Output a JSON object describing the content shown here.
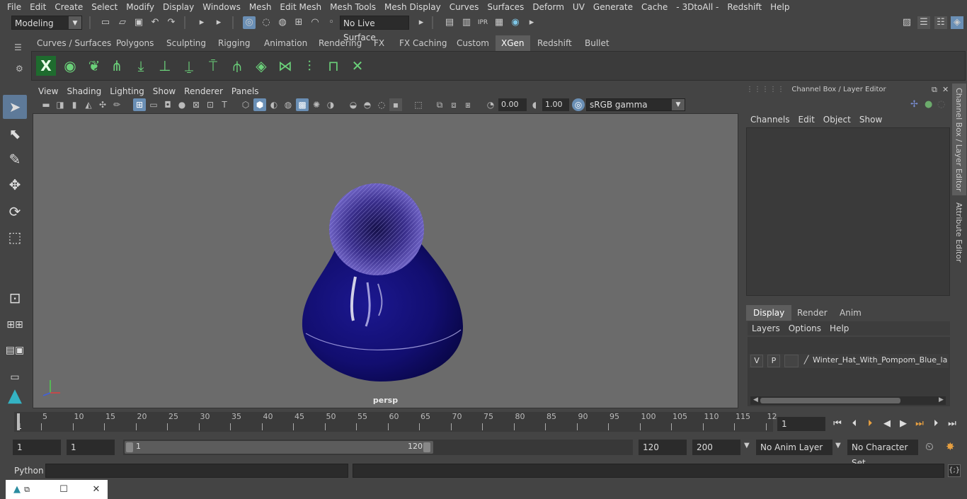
{
  "menubar": {
    "items": [
      "File",
      "Edit",
      "Create",
      "Select",
      "Modify",
      "Display",
      "Windows",
      "Mesh",
      "Edit Mesh",
      "Mesh Tools",
      "Mesh Display",
      "Curves",
      "Surfaces",
      "Deform",
      "UV",
      "Generate",
      "Cache",
      "- 3DtoAll -",
      "Redshift",
      "Help"
    ]
  },
  "statusline": {
    "mode": "Modeling",
    "live_surface": "No Live Surface"
  },
  "shelf": {
    "tabs": [
      "Curves / Surfaces",
      "Polygons",
      "Sculpting",
      "Rigging",
      "Animation",
      "Rendering",
      "FX",
      "FX Caching",
      "Custom",
      "XGen",
      "Redshift",
      "Bullet"
    ],
    "active_tab": "XGen"
  },
  "viewport": {
    "menu": [
      "View",
      "Shading",
      "Lighting",
      "Show",
      "Renderer",
      "Panels"
    ],
    "exposure": "0.00",
    "gamma": "1.00",
    "color_space": "sRGB gamma",
    "camera_label": "persp"
  },
  "channel_box": {
    "title": "Channel Box / Layer Editor",
    "menu": [
      "Channels",
      "Edit",
      "Object",
      "Show"
    ],
    "layer_tabs": [
      "Display",
      "Render",
      "Anim"
    ],
    "active_layer_tab": "Display",
    "layer_menu": [
      "Layers",
      "Options",
      "Help"
    ],
    "layer": {
      "v": "V",
      "p": "P",
      "name": "Winter_Hat_With_Pompom_Blue_layer"
    }
  },
  "side_tabs": [
    "Channel Box / Layer Editor",
    "Attribute Editor"
  ],
  "timeline": {
    "start_label": "1",
    "ticks": [
      "5",
      "10",
      "15",
      "20",
      "25",
      "30",
      "35",
      "40",
      "45",
      "50",
      "55",
      "60",
      "65",
      "70",
      "75",
      "80",
      "85",
      "90",
      "95",
      "100",
      "105",
      "110",
      "115",
      "12"
    ],
    "current_frame": "1"
  },
  "range": {
    "start": "1",
    "playback_start": "1",
    "slider_start": "1",
    "slider_end": "120",
    "playback_end": "120",
    "end": "200",
    "anim_layer": "No Anim Layer",
    "character_set": "No Character Set"
  },
  "command_line": {
    "label": "Python"
  }
}
